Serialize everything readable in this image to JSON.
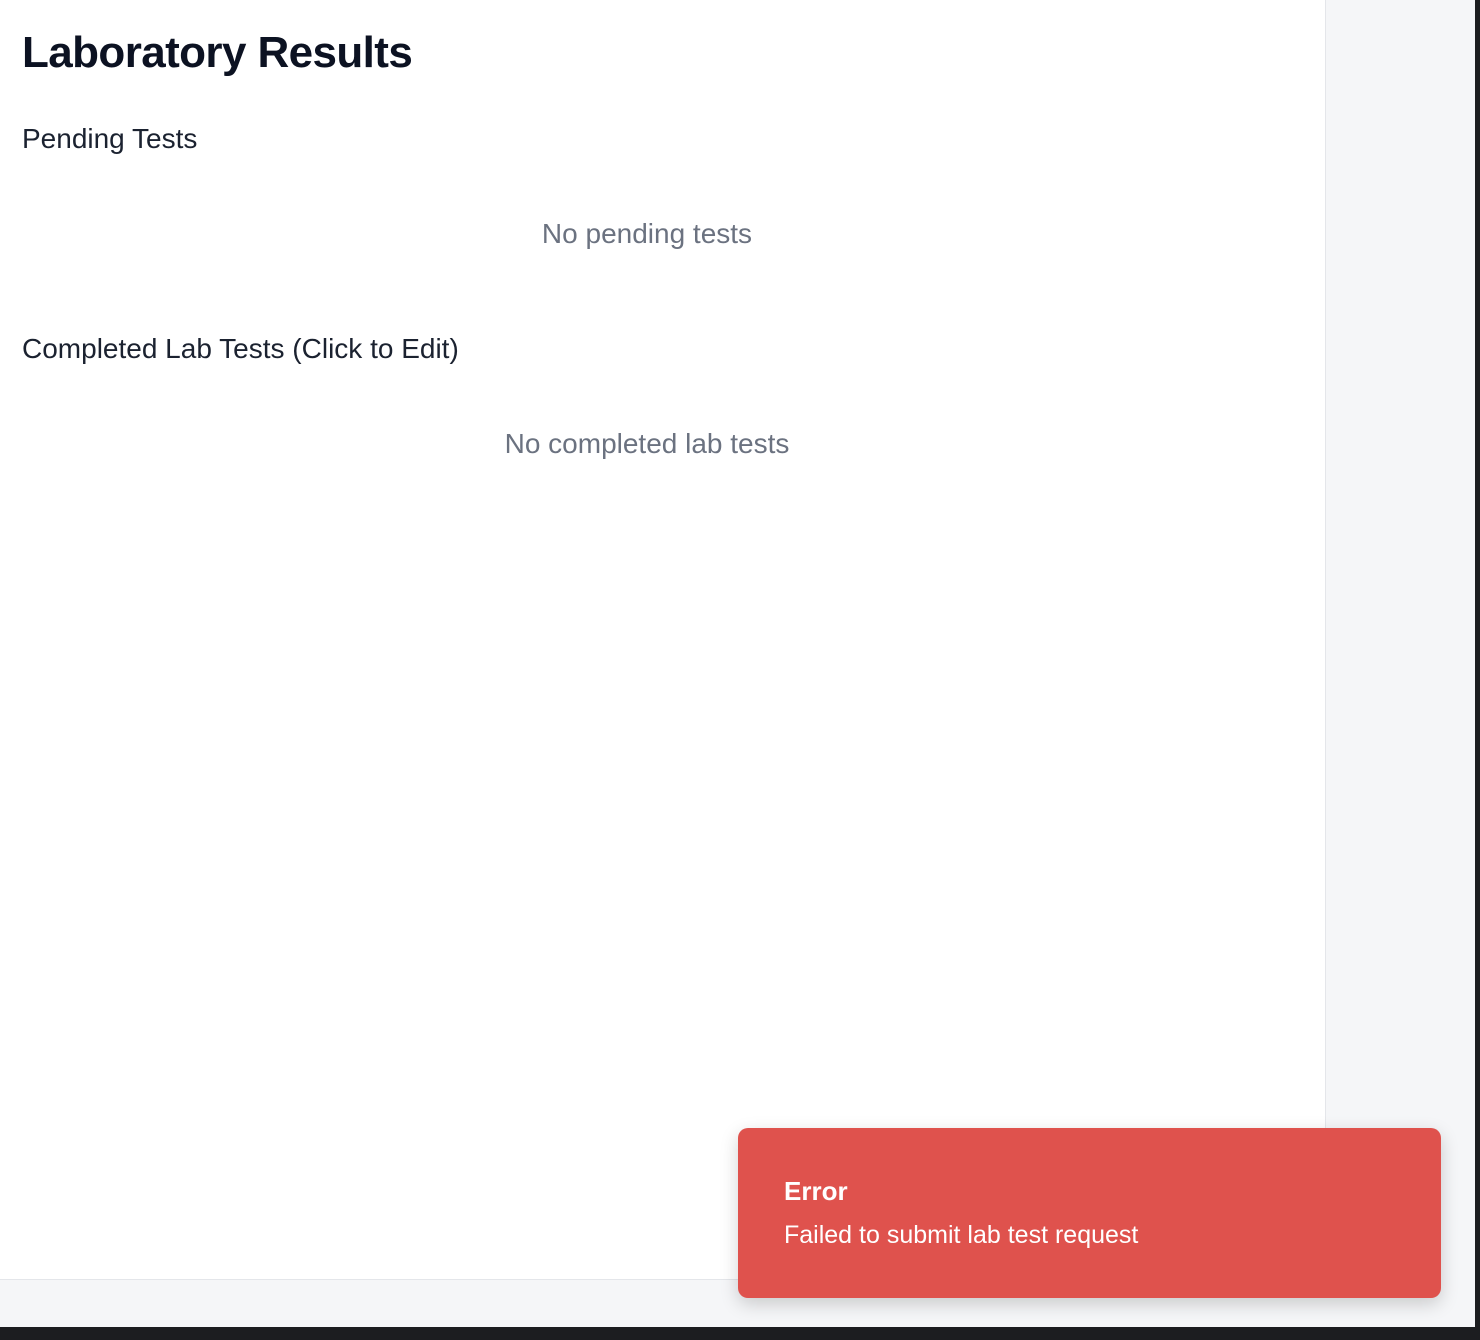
{
  "page": {
    "title": "Laboratory Results"
  },
  "pending": {
    "heading": "Pending Tests",
    "empty_text": "No pending tests"
  },
  "completed": {
    "heading": "Completed Lab Tests (Click to Edit)",
    "empty_text": "No completed lab tests"
  },
  "toast": {
    "title": "Error",
    "message": "Failed to submit lab test request"
  },
  "colors": {
    "page_background": "#f5f6f8",
    "card_background": "#ffffff",
    "title_text": "#0c1222",
    "muted_text": "#6b7280",
    "error_toast": "#df524d"
  }
}
